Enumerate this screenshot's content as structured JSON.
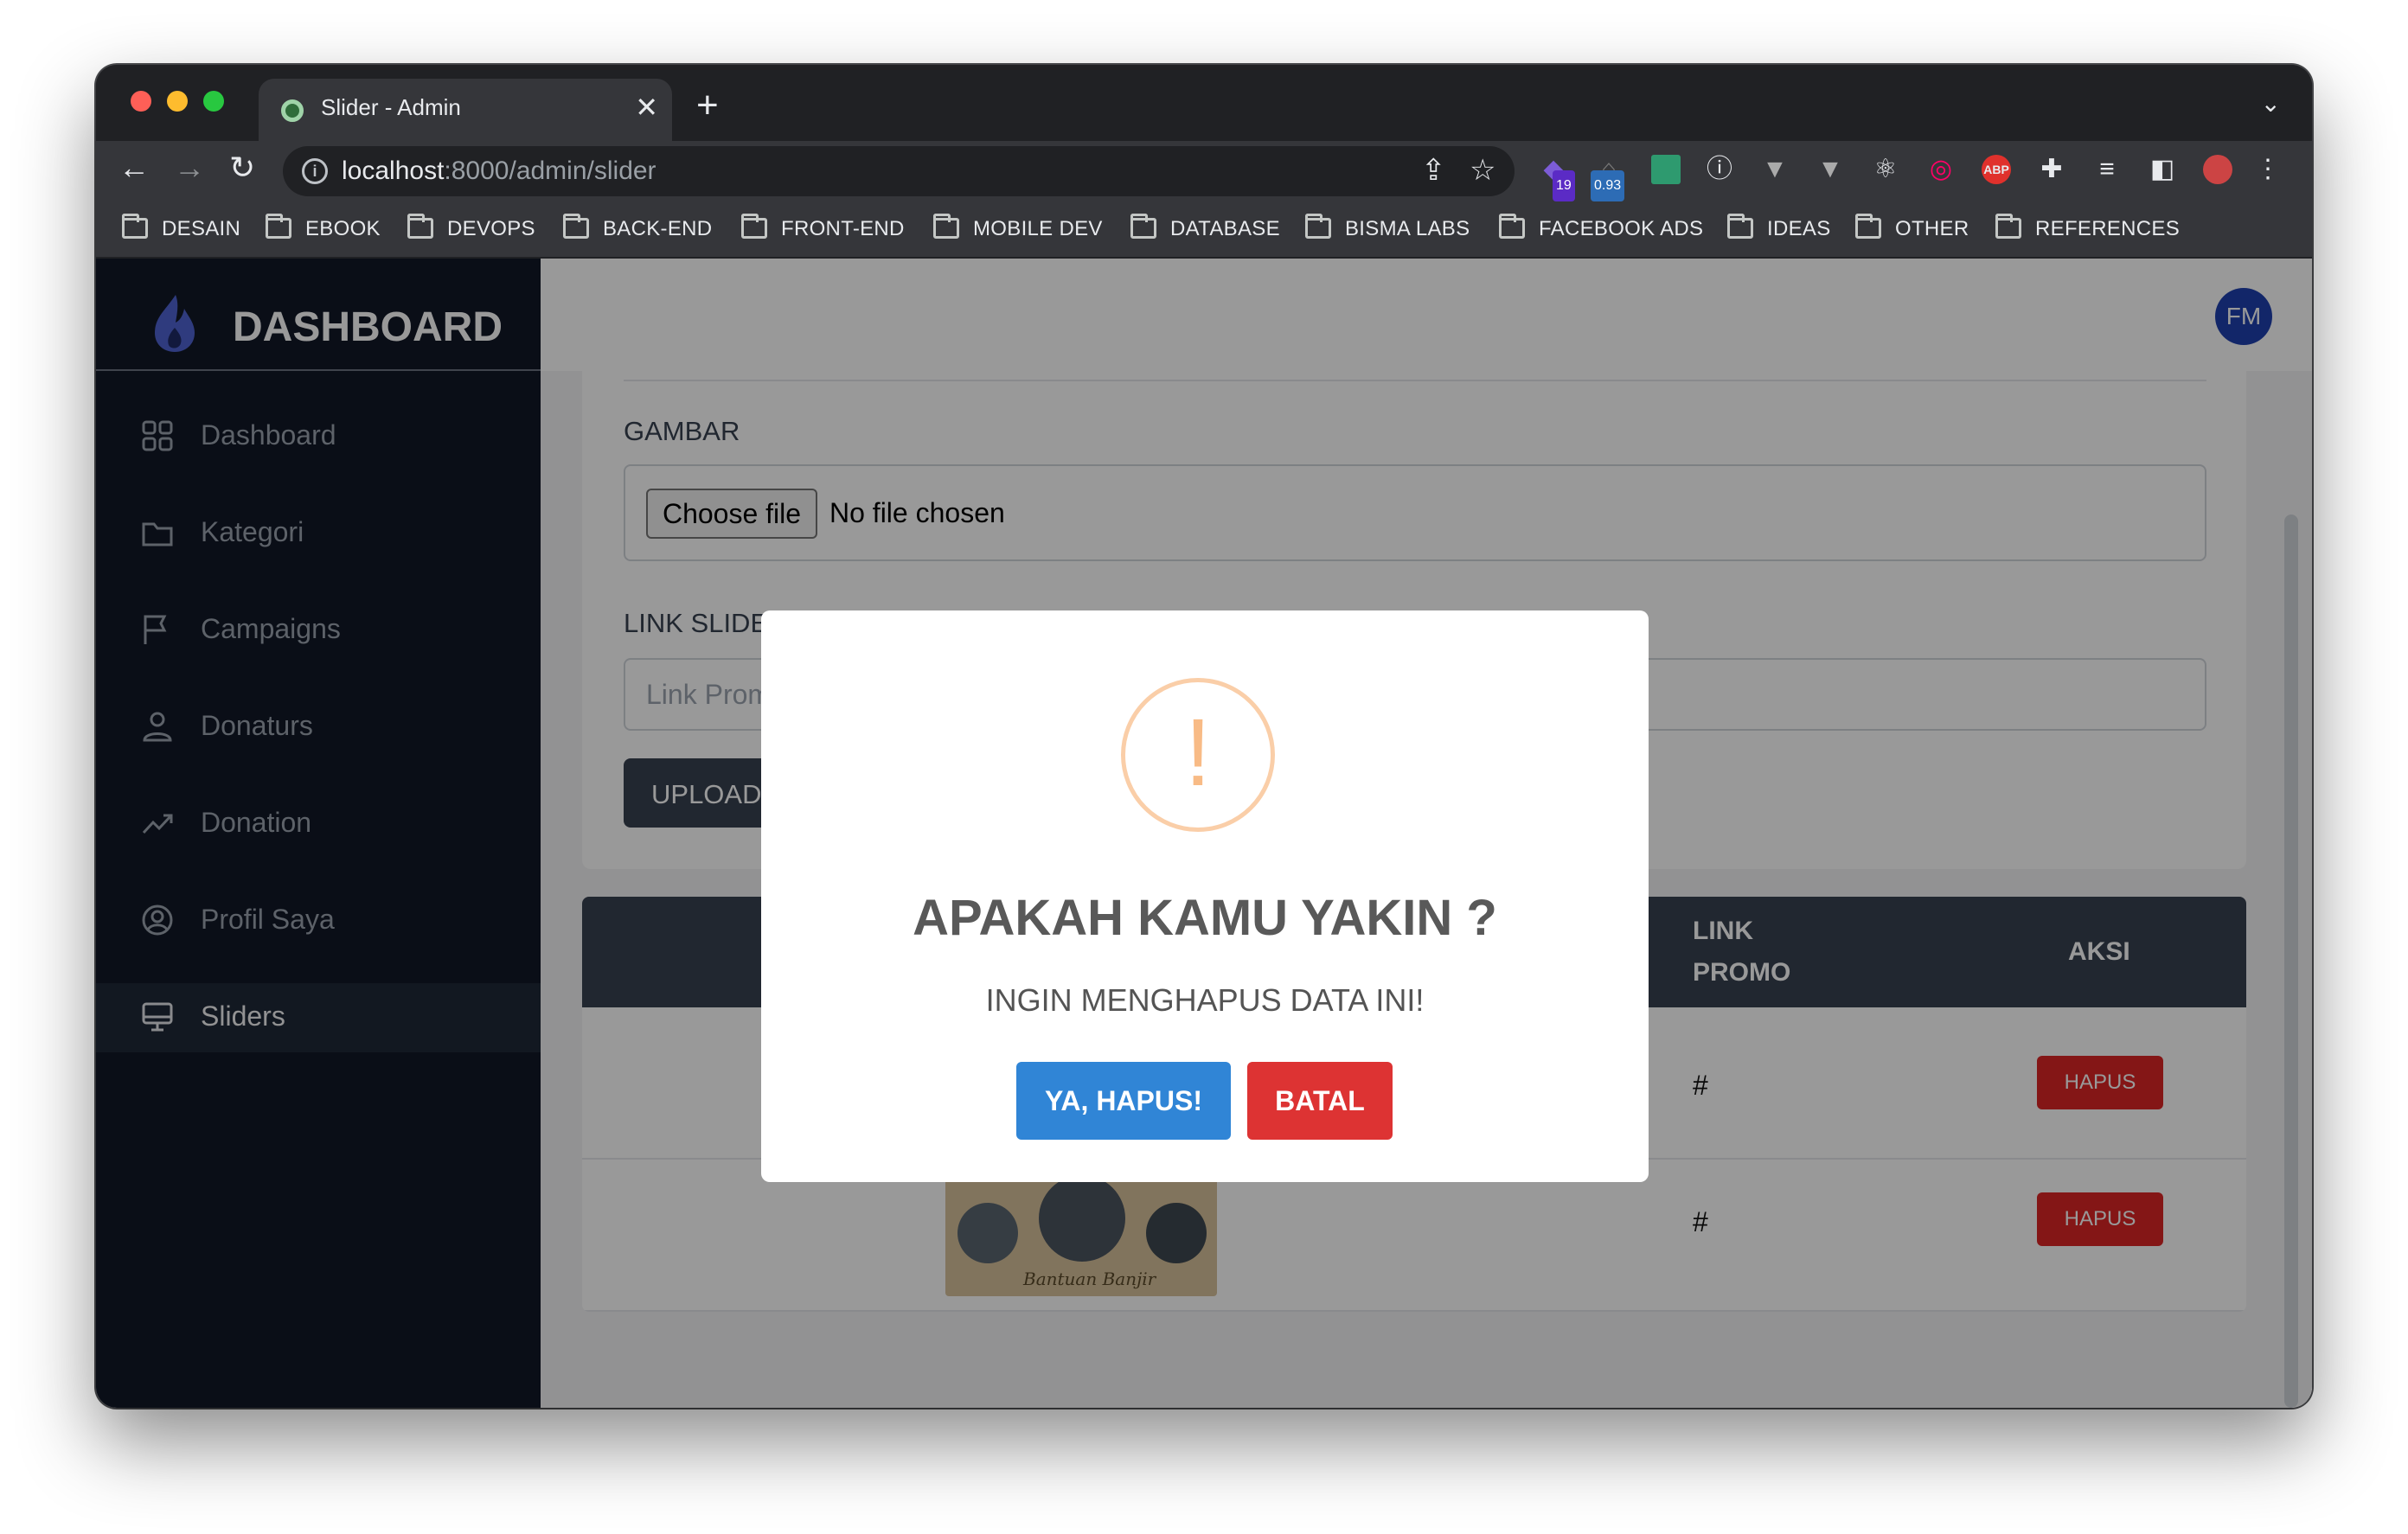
{
  "browser": {
    "tab_title": "Slider - Admin",
    "tab_close": "✕",
    "new_tab": "+",
    "url_host": "localhost",
    "url_path": ":8000/admin/slider",
    "extension_badges": [
      "19",
      "0.93"
    ],
    "bookmarks": [
      "DESAIN",
      "EBOOK",
      "DEVOPS",
      "BACK-END",
      "FRONT-END",
      "MOBILE DEV",
      "DATABASE",
      "BISMA LABS",
      "FACEBOOK ADS",
      "IDEAS",
      "OTHER",
      "REFERENCES"
    ]
  },
  "sidebar": {
    "brand": "DASHBOARD",
    "items": [
      {
        "label": "Dashboard",
        "icon": "grid-icon"
      },
      {
        "label": "Kategori",
        "icon": "folder-icon"
      },
      {
        "label": "Campaigns",
        "icon": "flag-icon"
      },
      {
        "label": "Donaturs",
        "icon": "users-icon"
      },
      {
        "label": "Donation",
        "icon": "trending-up-icon"
      },
      {
        "label": "Profil Saya",
        "icon": "user-circle-icon"
      },
      {
        "label": "Sliders",
        "icon": "monitor-icon",
        "active": true
      }
    ]
  },
  "header": {
    "avatar_initials": "FM"
  },
  "form": {
    "gambar_label": "GAMBAR",
    "choose_file": "Choose file",
    "no_file": "No file chosen",
    "link_label": "LINK SLIDER",
    "link_placeholder": "Link Promo",
    "upload_button": "UPLOAD"
  },
  "table": {
    "headers": {
      "link_promo_1": "LINK",
      "link_promo_2": "PROMO",
      "aksi": "AKSI"
    },
    "rows": [
      {
        "link": "#",
        "action": "HAPUS"
      },
      {
        "link": "#",
        "action": "HAPUS",
        "thumb_caption": "Bantuan Banjir"
      }
    ]
  },
  "modal": {
    "icon": "!",
    "title": "APAKAH KAMU YAKIN ?",
    "text": "INGIN MENGHAPUS DATA INI!",
    "confirm": "YA, HAPUS!",
    "cancel": "BATAL"
  },
  "colors": {
    "confirm": "#3085d6",
    "cancel": "#dd3333",
    "hapus": "#dc2626",
    "sidebar": "#111827",
    "avatar": "#1e40af"
  }
}
